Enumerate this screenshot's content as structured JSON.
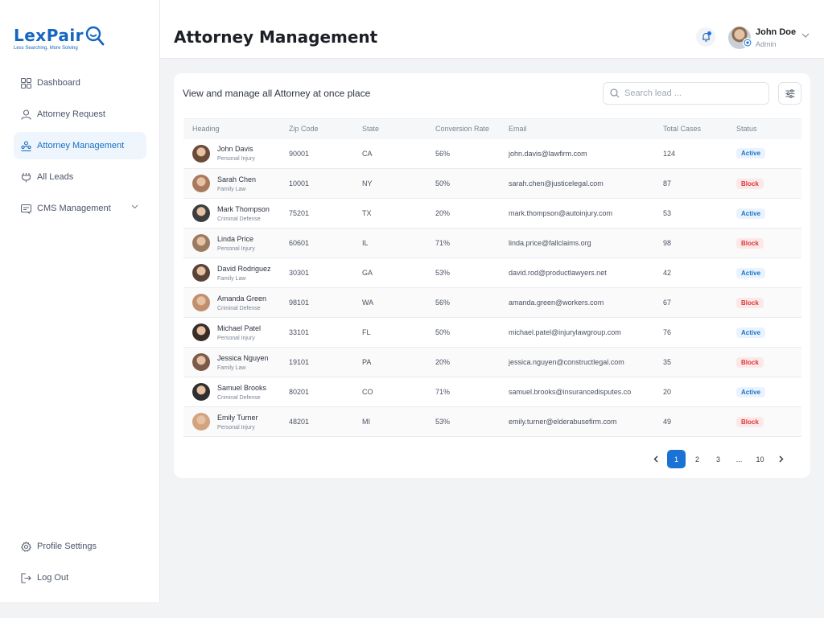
{
  "brand": {
    "name": "LexPair",
    "tagline": "Less Searching, More Solving",
    "color": "#1565c0"
  },
  "sidebar": {
    "items": [
      {
        "label": "Dashboard",
        "icon": "grid-icon"
      },
      {
        "label": "Attorney Request",
        "icon": "user-icon"
      },
      {
        "label": "Attorney Management",
        "icon": "people-icon",
        "active": true
      },
      {
        "label": "All Leads",
        "icon": "lead-icon"
      },
      {
        "label": "CMS Management",
        "icon": "cms-icon",
        "has_submenu": true
      }
    ],
    "bottom": [
      {
        "label": "Profile Settings",
        "icon": "gear-icon"
      },
      {
        "label": "Log Out",
        "icon": "logout-icon"
      }
    ]
  },
  "header": {
    "title": "Attorney Management",
    "user": {
      "name": "John Doe",
      "role": "Admin"
    }
  },
  "main": {
    "subtitle": "View and manage all Attorney at once place",
    "search_placeholder": "Search lead ...",
    "columns": [
      "Heading",
      "Zip Code",
      "State",
      "Conversion Rate",
      "Email",
      "Total Cases",
      "Status"
    ],
    "rows": [
      {
        "name": "John Davis",
        "area": "Personal Injury",
        "zip": "90001",
        "state": "CA",
        "rate": "56%",
        "email": "john.davis@lawfirm.com",
        "cases": "124",
        "status": "Active"
      },
      {
        "name": "Sarah Chen",
        "area": "Family Law",
        "zip": "10001",
        "state": "NY",
        "rate": "50%",
        "email": "sarah.chen@justicelegal.com",
        "cases": "87",
        "status": "Block"
      },
      {
        "name": "Mark Thompson",
        "area": "Criminal Defense",
        "zip": "75201",
        "state": "TX",
        "rate": "20%",
        "email": "mark.thompson@autoinjury.com",
        "cases": "53",
        "status": "Active"
      },
      {
        "name": "Linda Price",
        "area": "Personal Injury",
        "zip": "60601",
        "state": "IL",
        "rate": "71%",
        "email": "linda.price@fallclaims.org",
        "cases": "98",
        "status": "Block"
      },
      {
        "name": "David Rodriguez",
        "area": "Family Law",
        "zip": "30301",
        "state": "GA",
        "rate": "53%",
        "email": "david.rod@productlawyers.net",
        "cases": "42",
        "status": "Active"
      },
      {
        "name": "Amanda Green",
        "area": "Criminal Defense",
        "zip": "98101",
        "state": "WA",
        "rate": "56%",
        "email": "amanda.green@workers.com",
        "cases": "67",
        "status": "Block"
      },
      {
        "name": "Michael Patel",
        "area": "Personal Injury",
        "zip": "33101",
        "state": "FL",
        "rate": "50%",
        "email": "michael.patel@injurylawgroup.com",
        "cases": "76",
        "status": "Active"
      },
      {
        "name": "Jessica Nguyen",
        "area": "Family Law",
        "zip": "19101",
        "state": "PA",
        "rate": "20%",
        "email": "jessica.nguyen@constructlegal.com",
        "cases": "35",
        "status": "Block"
      },
      {
        "name": "Samuel Brooks",
        "area": "Criminal Defense",
        "zip": "80201",
        "state": "CO",
        "rate": "71%",
        "email": "samuel.brooks@insurancedisputes.co",
        "cases": "20",
        "status": "Active"
      },
      {
        "name": "Emily Turner",
        "area": "Personal Injury",
        "zip": "48201",
        "state": "MI",
        "rate": "53%",
        "email": "emily.turner@elderabusefirm.com",
        "cases": "49",
        "status": "Block"
      }
    ],
    "pagination": {
      "pages": [
        "1",
        "2",
        "3",
        "...",
        "10"
      ],
      "current": "1"
    }
  },
  "colors": {
    "accent": "#1a73d4",
    "active_text": "#1a73c8",
    "block_text": "#d9383a"
  }
}
